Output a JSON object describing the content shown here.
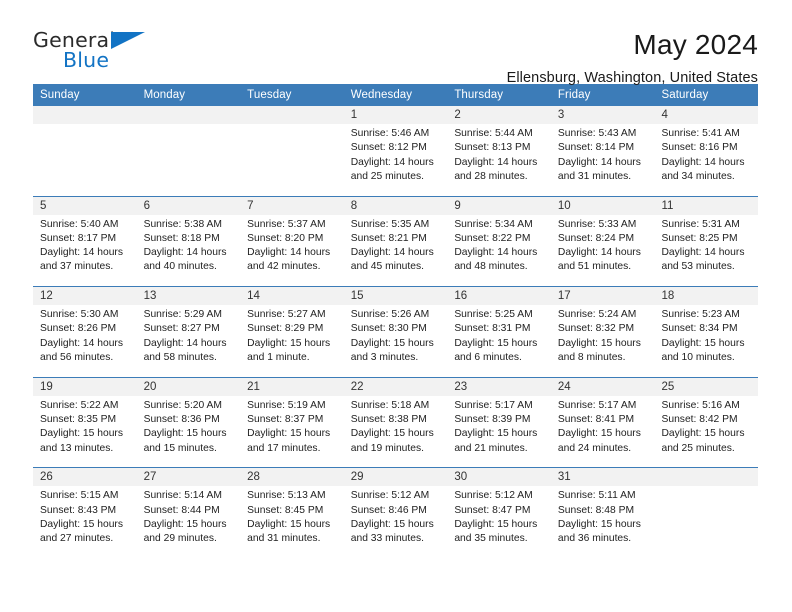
{
  "logo": {
    "word_top": "General",
    "word_bottom": "Blue",
    "accent_color": "#1273c4"
  },
  "header": {
    "title": "May 2024",
    "subtitle": "Ellensburg, Washington, United States"
  },
  "calendar": {
    "header_color": "#3c7cb8",
    "day_band_color": "#f2f2f2",
    "weekday_names": [
      "Sunday",
      "Monday",
      "Tuesday",
      "Wednesday",
      "Thursday",
      "Friday",
      "Saturday"
    ],
    "weeks": [
      [
        {
          "day": "",
          "empty": true
        },
        {
          "day": "",
          "empty": true
        },
        {
          "day": "",
          "empty": true
        },
        {
          "day": "1",
          "sunrise": "Sunrise: 5:46 AM",
          "sunset": "Sunset: 8:12 PM",
          "daylight": "Daylight: 14 hours and 25 minutes."
        },
        {
          "day": "2",
          "sunrise": "Sunrise: 5:44 AM",
          "sunset": "Sunset: 8:13 PM",
          "daylight": "Daylight: 14 hours and 28 minutes."
        },
        {
          "day": "3",
          "sunrise": "Sunrise: 5:43 AM",
          "sunset": "Sunset: 8:14 PM",
          "daylight": "Daylight: 14 hours and 31 minutes."
        },
        {
          "day": "4",
          "sunrise": "Sunrise: 5:41 AM",
          "sunset": "Sunset: 8:16 PM",
          "daylight": "Daylight: 14 hours and 34 minutes."
        }
      ],
      [
        {
          "day": "5",
          "sunrise": "Sunrise: 5:40 AM",
          "sunset": "Sunset: 8:17 PM",
          "daylight": "Daylight: 14 hours and 37 minutes."
        },
        {
          "day": "6",
          "sunrise": "Sunrise: 5:38 AM",
          "sunset": "Sunset: 8:18 PM",
          "daylight": "Daylight: 14 hours and 40 minutes."
        },
        {
          "day": "7",
          "sunrise": "Sunrise: 5:37 AM",
          "sunset": "Sunset: 8:20 PM",
          "daylight": "Daylight: 14 hours and 42 minutes."
        },
        {
          "day": "8",
          "sunrise": "Sunrise: 5:35 AM",
          "sunset": "Sunset: 8:21 PM",
          "daylight": "Daylight: 14 hours and 45 minutes."
        },
        {
          "day": "9",
          "sunrise": "Sunrise: 5:34 AM",
          "sunset": "Sunset: 8:22 PM",
          "daylight": "Daylight: 14 hours and 48 minutes."
        },
        {
          "day": "10",
          "sunrise": "Sunrise: 5:33 AM",
          "sunset": "Sunset: 8:24 PM",
          "daylight": "Daylight: 14 hours and 51 minutes."
        },
        {
          "day": "11",
          "sunrise": "Sunrise: 5:31 AM",
          "sunset": "Sunset: 8:25 PM",
          "daylight": "Daylight: 14 hours and 53 minutes."
        }
      ],
      [
        {
          "day": "12",
          "sunrise": "Sunrise: 5:30 AM",
          "sunset": "Sunset: 8:26 PM",
          "daylight": "Daylight: 14 hours and 56 minutes."
        },
        {
          "day": "13",
          "sunrise": "Sunrise: 5:29 AM",
          "sunset": "Sunset: 8:27 PM",
          "daylight": "Daylight: 14 hours and 58 minutes."
        },
        {
          "day": "14",
          "sunrise": "Sunrise: 5:27 AM",
          "sunset": "Sunset: 8:29 PM",
          "daylight": "Daylight: 15 hours and 1 minute."
        },
        {
          "day": "15",
          "sunrise": "Sunrise: 5:26 AM",
          "sunset": "Sunset: 8:30 PM",
          "daylight": "Daylight: 15 hours and 3 minutes."
        },
        {
          "day": "16",
          "sunrise": "Sunrise: 5:25 AM",
          "sunset": "Sunset: 8:31 PM",
          "daylight": "Daylight: 15 hours and 6 minutes."
        },
        {
          "day": "17",
          "sunrise": "Sunrise: 5:24 AM",
          "sunset": "Sunset: 8:32 PM",
          "daylight": "Daylight: 15 hours and 8 minutes."
        },
        {
          "day": "18",
          "sunrise": "Sunrise: 5:23 AM",
          "sunset": "Sunset: 8:34 PM",
          "daylight": "Daylight: 15 hours and 10 minutes."
        }
      ],
      [
        {
          "day": "19",
          "sunrise": "Sunrise: 5:22 AM",
          "sunset": "Sunset: 8:35 PM",
          "daylight": "Daylight: 15 hours and 13 minutes."
        },
        {
          "day": "20",
          "sunrise": "Sunrise: 5:20 AM",
          "sunset": "Sunset: 8:36 PM",
          "daylight": "Daylight: 15 hours and 15 minutes."
        },
        {
          "day": "21",
          "sunrise": "Sunrise: 5:19 AM",
          "sunset": "Sunset: 8:37 PM",
          "daylight": "Daylight: 15 hours and 17 minutes."
        },
        {
          "day": "22",
          "sunrise": "Sunrise: 5:18 AM",
          "sunset": "Sunset: 8:38 PM",
          "daylight": "Daylight: 15 hours and 19 minutes."
        },
        {
          "day": "23",
          "sunrise": "Sunrise: 5:17 AM",
          "sunset": "Sunset: 8:39 PM",
          "daylight": "Daylight: 15 hours and 21 minutes."
        },
        {
          "day": "24",
          "sunrise": "Sunrise: 5:17 AM",
          "sunset": "Sunset: 8:41 PM",
          "daylight": "Daylight: 15 hours and 24 minutes."
        },
        {
          "day": "25",
          "sunrise": "Sunrise: 5:16 AM",
          "sunset": "Sunset: 8:42 PM",
          "daylight": "Daylight: 15 hours and 25 minutes."
        }
      ],
      [
        {
          "day": "26",
          "sunrise": "Sunrise: 5:15 AM",
          "sunset": "Sunset: 8:43 PM",
          "daylight": "Daylight: 15 hours and 27 minutes."
        },
        {
          "day": "27",
          "sunrise": "Sunrise: 5:14 AM",
          "sunset": "Sunset: 8:44 PM",
          "daylight": "Daylight: 15 hours and 29 minutes."
        },
        {
          "day": "28",
          "sunrise": "Sunrise: 5:13 AM",
          "sunset": "Sunset: 8:45 PM",
          "daylight": "Daylight: 15 hours and 31 minutes."
        },
        {
          "day": "29",
          "sunrise": "Sunrise: 5:12 AM",
          "sunset": "Sunset: 8:46 PM",
          "daylight": "Daylight: 15 hours and 33 minutes."
        },
        {
          "day": "30",
          "sunrise": "Sunrise: 5:12 AM",
          "sunset": "Sunset: 8:47 PM",
          "daylight": "Daylight: 15 hours and 35 minutes."
        },
        {
          "day": "31",
          "sunrise": "Sunrise: 5:11 AM",
          "sunset": "Sunset: 8:48 PM",
          "daylight": "Daylight: 15 hours and 36 minutes."
        },
        {
          "day": "",
          "empty": true
        }
      ]
    ]
  }
}
